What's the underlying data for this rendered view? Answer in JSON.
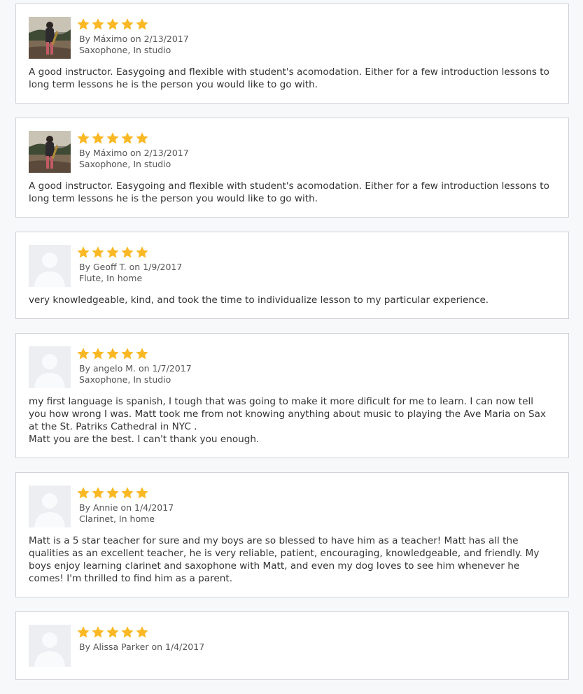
{
  "colors": {
    "star": "#f9b824",
    "card_border": "#cfd3d8",
    "page_background": "#f7f8fa"
  },
  "reviews": [
    {
      "avatar": "photo-avatar",
      "rating": 5,
      "byline": "By Máximo on 2/13/2017",
      "lesson": "Saxophone, In studio",
      "text": [
        "A good instructor. Easygoing and flexible with student's acomodation. Either for a few introduction lessons to long term lessons he is the person you would like to go with."
      ]
    },
    {
      "avatar": "photo-avatar",
      "rating": 5,
      "byline": "By Máximo on 2/13/2017",
      "lesson": "Saxophone, In studio",
      "text": [
        "A good instructor. Easygoing and flexible with student's acomodation. Either for a few introduction lessons to long term lessons he is the person you would like to go with."
      ]
    },
    {
      "avatar": "placeholder-avatar",
      "rating": 5,
      "byline": "By Geoff T. on 1/9/2017",
      "lesson": "Flute, In home",
      "text": [
        "very knowledgeable, kind, and took the time to individualize lesson to my particular experience."
      ]
    },
    {
      "avatar": "placeholder-avatar",
      "rating": 5,
      "byline": "By angelo M. on 1/7/2017",
      "lesson": "Saxophone, In studio",
      "text": [
        "my first language is spanish, I tough that was going to make it more dificult for me to learn. I can now tell you how wrong I was. Matt took me from not knowing anything about music to playing the Ave Maria on Sax at the St. Patriks Cathedral in NYC .",
        "Matt you are the best. I can't thank you enough."
      ]
    },
    {
      "avatar": "placeholder-avatar",
      "rating": 5,
      "byline": "By Annie on 1/4/2017",
      "lesson": "Clarinet, In home",
      "text": [
        "Matt is a 5 star teacher for sure and my boys are so blessed to have him as a teacher! Matt has all the qualities as an excellent teacher, he is very reliable, patient, encouraging, knowledgeable, and friendly. My boys enjoy learning clarinet and saxophone with Matt, and even my dog loves to see him whenever he comes! I'm thrilled to find him as a parent."
      ]
    },
    {
      "avatar": "placeholder-avatar",
      "rating": 5,
      "byline": "By Alissa Parker on 1/4/2017",
      "lesson": "",
      "text": []
    }
  ]
}
